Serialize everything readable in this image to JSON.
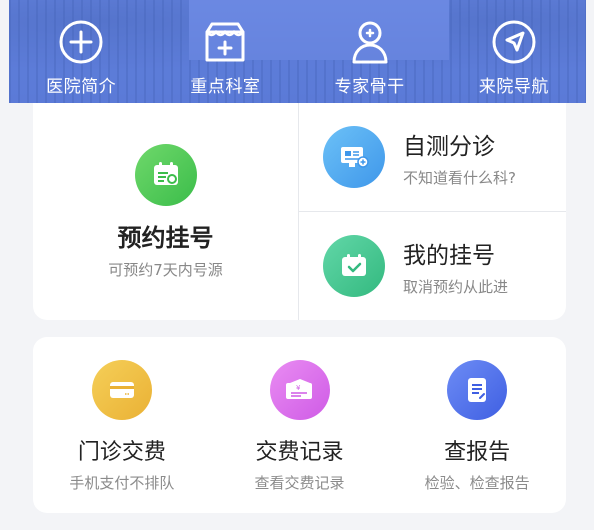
{
  "header": {
    "nav": [
      {
        "label": "医院简介",
        "icon": "hospital-cross-icon"
      },
      {
        "label": "重点科室",
        "icon": "department-box-icon"
      },
      {
        "label": "专家骨干",
        "icon": "doctor-icon"
      },
      {
        "label": "来院导航",
        "icon": "navigation-arrow-icon"
      }
    ]
  },
  "booking": {
    "title": "预约挂号",
    "subtitle": "可预约7天内号源",
    "icon": "calendar-icon",
    "color": "#3bbd4a"
  },
  "self_triage": {
    "title": "自测分诊",
    "subtitle": "不知道看什么科?",
    "icon": "monitor-icon",
    "color": "#3f97ea"
  },
  "my_registration": {
    "title": "我的挂号",
    "subtitle": "取消预约从此进",
    "icon": "calendar-check-icon",
    "color": "#33b97f"
  },
  "services": [
    {
      "title": "门诊交费",
      "subtitle": "手机支付不排队",
      "icon": "card-icon",
      "color": "#eab135"
    },
    {
      "title": "交费记录",
      "subtitle": "查看交费记录",
      "icon": "bill-icon",
      "color": "#cf5be6"
    },
    {
      "title": "查报告",
      "subtitle": "检验、检查报告",
      "icon": "report-icon",
      "color": "#3f5fe2"
    }
  ],
  "colors": {
    "banner_overlay": "#466ee6",
    "background": "#f3f4f7"
  }
}
